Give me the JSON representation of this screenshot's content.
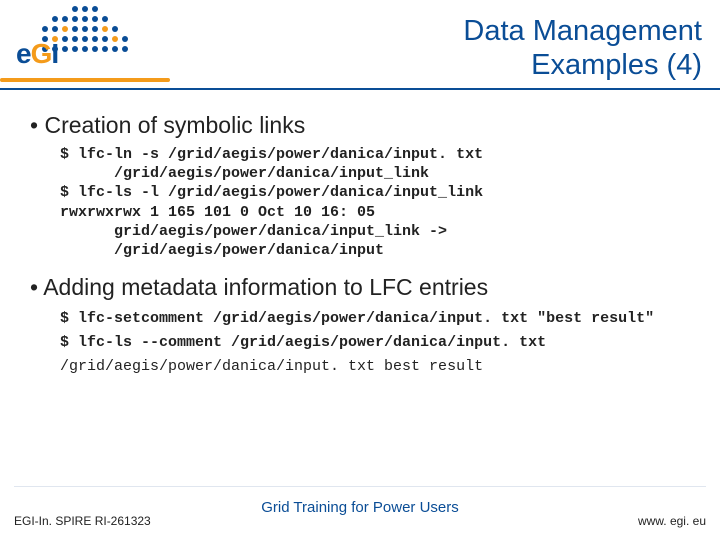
{
  "logo": {
    "brand_e": "e",
    "brand_g": "G",
    "brand_i": "I"
  },
  "title": {
    "line1": "Data Management",
    "line2": "Examples (4)"
  },
  "section1": {
    "heading": "Creation of symbolic links",
    "l1": "$ lfc-ln -s /grid/aegis/power/danica/input. txt",
    "l2": "/grid/aegis/power/danica/input_link",
    "l3": "$ lfc-ls -l /grid/aegis/power/danica/input_link",
    "l4": "rwxrwxrwx 1 165 101 0 Oct 10 16: 05",
    "l5": "grid/aegis/power/danica/input_link ->",
    "l6": "/grid/aegis/power/danica/input"
  },
  "section2": {
    "heading": "Adding metadata information to LFC entries",
    "l1": "$ lfc-setcomment /grid/aegis/power/danica/input. txt \"best result\"",
    "l2": "$ lfc-ls --comment /grid/aegis/power/danica/input. txt",
    "l3": "/grid/aegis/power/danica/input. txt best result"
  },
  "footer": {
    "left": "EGI-In. SPIRE RI-261323",
    "center": "Grid Training for Power Users",
    "right": "www. egi. eu"
  }
}
